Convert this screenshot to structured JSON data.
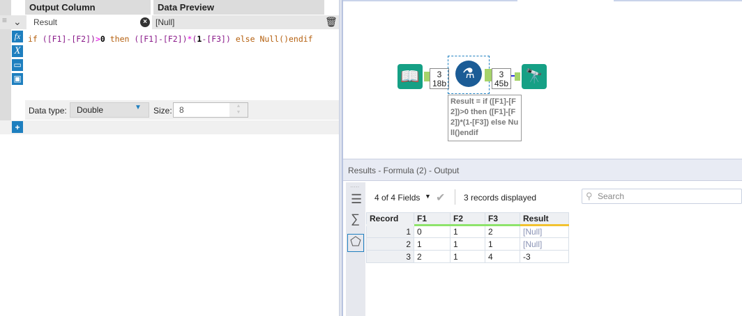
{
  "formula_panel": {
    "col_header": "Output Column",
    "preview_header": "Data Preview",
    "output_column": "Result",
    "preview_value": "[Null]",
    "expression_tokens": [
      {
        "t": "if ",
        "c": "k"
      },
      {
        "t": "([F1]-[F2])",
        "c": "p"
      },
      {
        "t": ">",
        "c": "m"
      },
      {
        "t": "0",
        "c": "n"
      },
      {
        "t": " then ",
        "c": "k"
      },
      {
        "t": "([F1]-[F2])",
        "c": "p"
      },
      {
        "t": "*",
        "c": "m"
      },
      {
        "t": "(",
        "c": "p"
      },
      {
        "t": "1",
        "c": "n"
      },
      {
        "t": "-[F3])",
        "c": "p"
      },
      {
        "t": " else Null()endif",
        "c": "k"
      }
    ],
    "data_type_label": "Data type:",
    "data_type": "Double",
    "size_label": "Size:",
    "size": "8",
    "icon_fx": "fx",
    "icon_x": "X"
  },
  "canvas": {
    "conn1_count": "3",
    "conn1_size": "18b",
    "conn2_count": "3",
    "conn2_size": "45b",
    "annotation": "Result = if ([F1]-[F2])>0 then ([F1]-[F2])*(1-[F3]) else Null()endif"
  },
  "results": {
    "title": "Results - Formula (2) - Output",
    "fields": "4 of 4 Fields",
    "records": "3 records displayed",
    "search_placeholder": "Search",
    "columns": [
      "Record",
      "F1",
      "F2",
      "F3",
      "Result"
    ],
    "rows": [
      [
        "1",
        "0",
        "1",
        "2",
        "[Null]"
      ],
      [
        "2",
        "1",
        "1",
        "1",
        "[Null]"
      ],
      [
        "3",
        "2",
        "1",
        "4",
        "-3"
      ]
    ]
  }
}
